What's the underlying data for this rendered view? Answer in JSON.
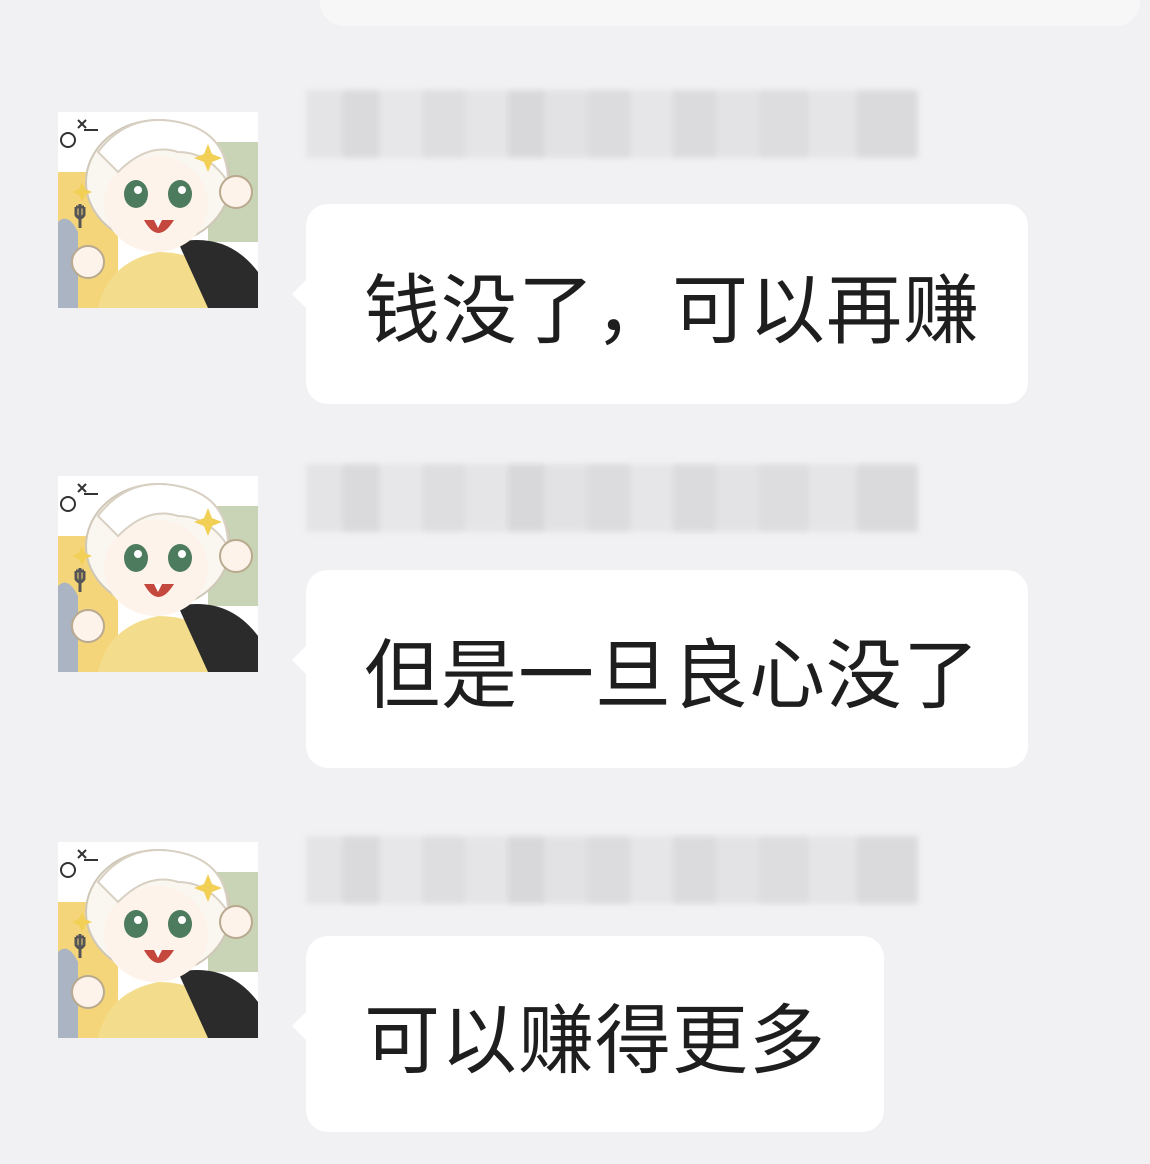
{
  "messages": [
    {
      "text": "钱没了，可以再赚",
      "avatar_icon": "anime-girl-avatar-icon",
      "nickname_blurred": true
    },
    {
      "text": "但是一旦良心没了",
      "avatar_icon": "anime-girl-avatar-icon",
      "nickname_blurred": true
    },
    {
      "text": "可以赚得更多",
      "avatar_icon": "anime-girl-avatar-icon",
      "nickname_blurred": true
    }
  ],
  "colors": {
    "background": "#f1f1f3",
    "bubble": "#ffffff",
    "text": "#1e1e1e"
  }
}
